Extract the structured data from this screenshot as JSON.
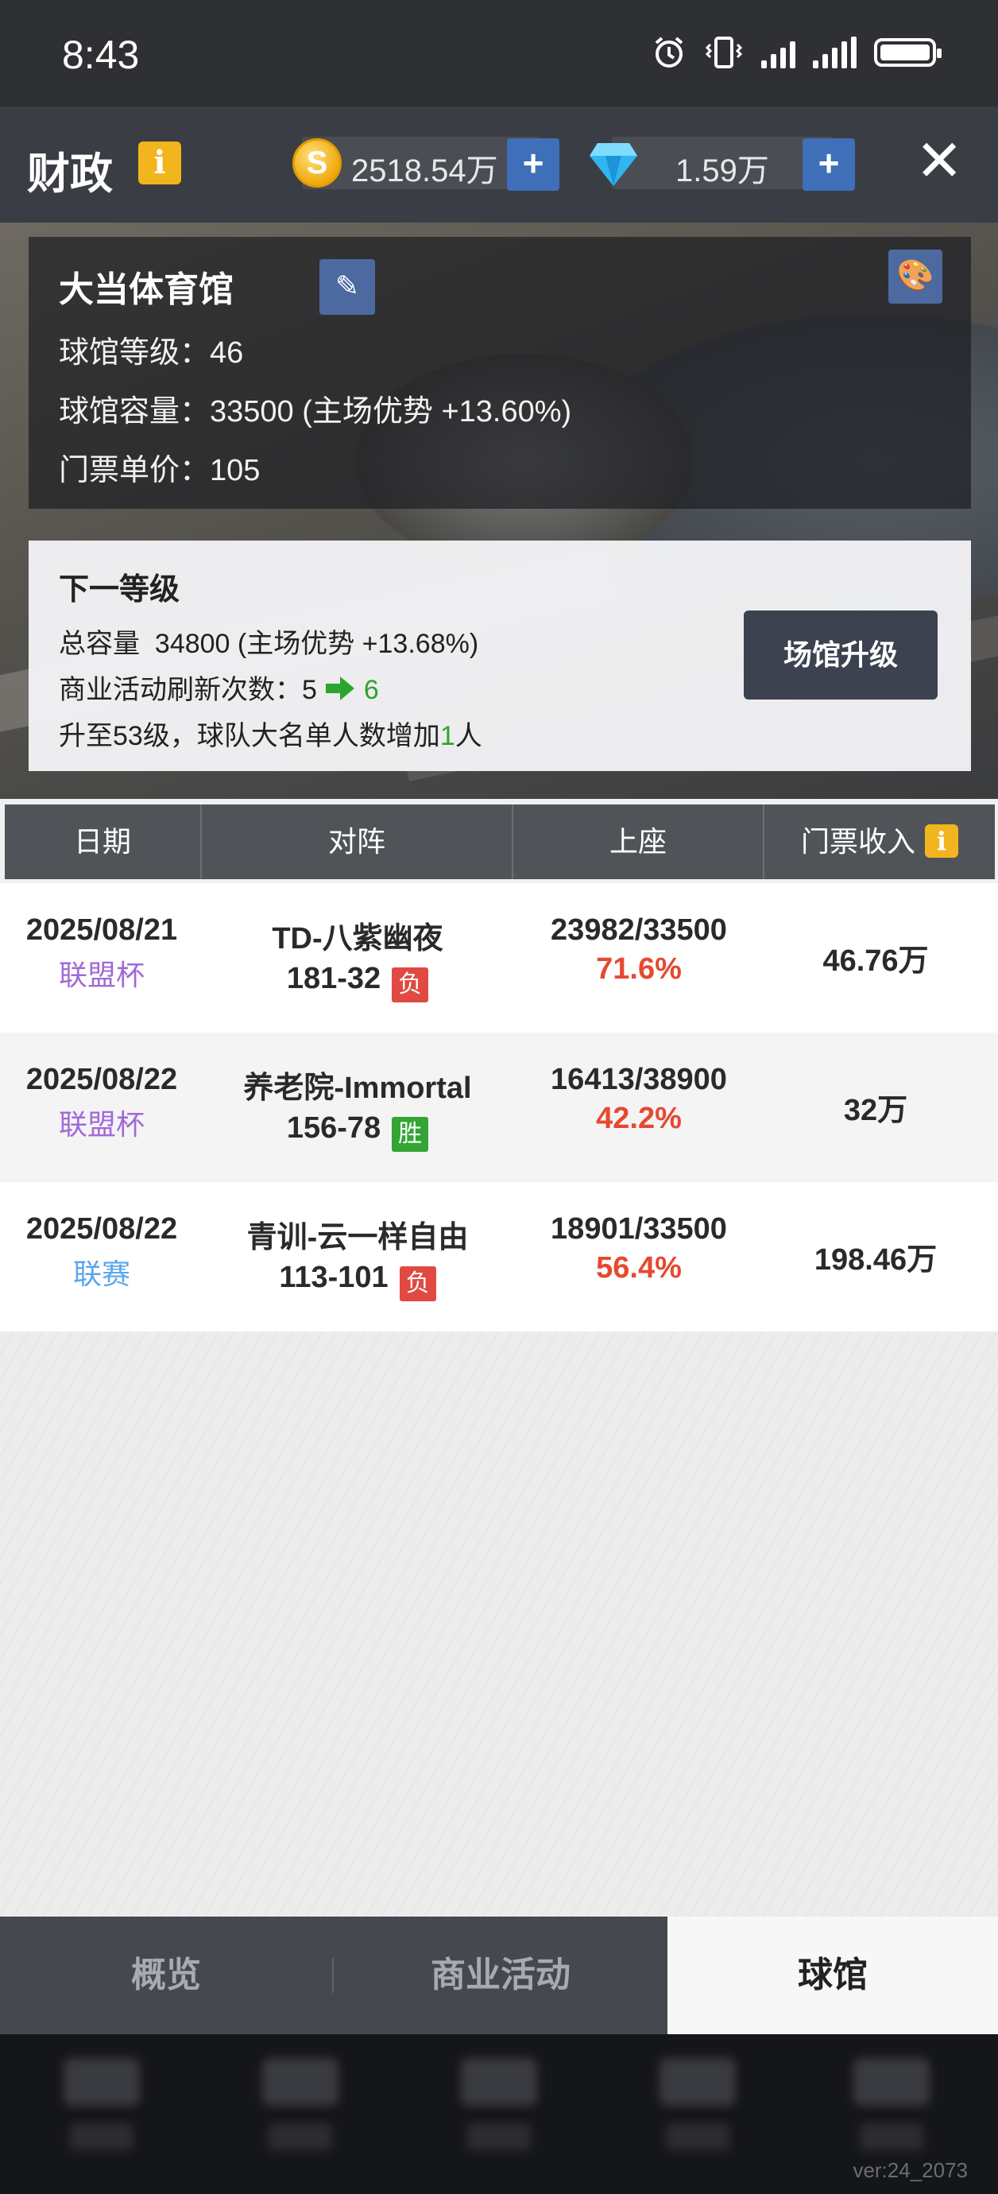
{
  "status_bar": {
    "time": "8:43",
    "icons": [
      "alarm-icon",
      "vibrate-icon",
      "signal-icon",
      "signal-icon",
      "battery-icon"
    ]
  },
  "header": {
    "title": "财政",
    "info_icon": "i",
    "coins": "2518.54万",
    "gems": "1.59万",
    "plus": "+",
    "close": "✕"
  },
  "stadium": {
    "name": "大当体育馆",
    "level_label": "球馆等级：",
    "level": "46",
    "capacity_label": "球馆容量：",
    "capacity": "33500 (主场优势 +13.60%)",
    "price_label": "门票单价：",
    "price": "105"
  },
  "next_level": {
    "title": "下一等级",
    "capacity_label": "总容量",
    "capacity": "34800 (主场优势 +13.68%)",
    "refresh_label": "商业活动刷新次数：",
    "refresh_from": "5",
    "refresh_to": "6",
    "roster_prefix": "升至53级，球队大名单人数增加",
    "roster_num": "1",
    "roster_suffix": "人",
    "upgrade_button": "场馆升级"
  },
  "table": {
    "headers": [
      "日期",
      "对阵",
      "上座",
      "门票收入"
    ],
    "rows": [
      {
        "date": "2025/08/21",
        "type": "联盟杯",
        "opponent": "TD-八紫幽夜",
        "score": "181-32",
        "result": "负",
        "seats": "23982/33500",
        "pct": "71.6%",
        "income": "46.76万"
      },
      {
        "date": "2025/08/22",
        "type": "联盟杯",
        "opponent": "养老院-Immortal",
        "score": "156-78",
        "result": "胜",
        "seats": "16413/38900",
        "pct": "42.2%",
        "income": "32万"
      },
      {
        "date": "2025/08/22",
        "type": "联赛",
        "opponent": "青训-云一样自由",
        "score": "113-101",
        "result": "负",
        "seats": "18901/33500",
        "pct": "56.4%",
        "income": "198.46万"
      }
    ]
  },
  "tabs": {
    "overview": "概览",
    "business": "商业活动",
    "stadium": "球馆",
    "active": "球馆"
  },
  "version": "ver:24_2073",
  "colors": {
    "accent_blue": "#3f6fb8",
    "badge_yellow": "#f3b51d",
    "lose_red": "#e04a43",
    "win_green": "#34a534",
    "pct_red": "#e7482f",
    "cup_purple": "#a06ad6",
    "league_blue": "#59a6ea"
  }
}
